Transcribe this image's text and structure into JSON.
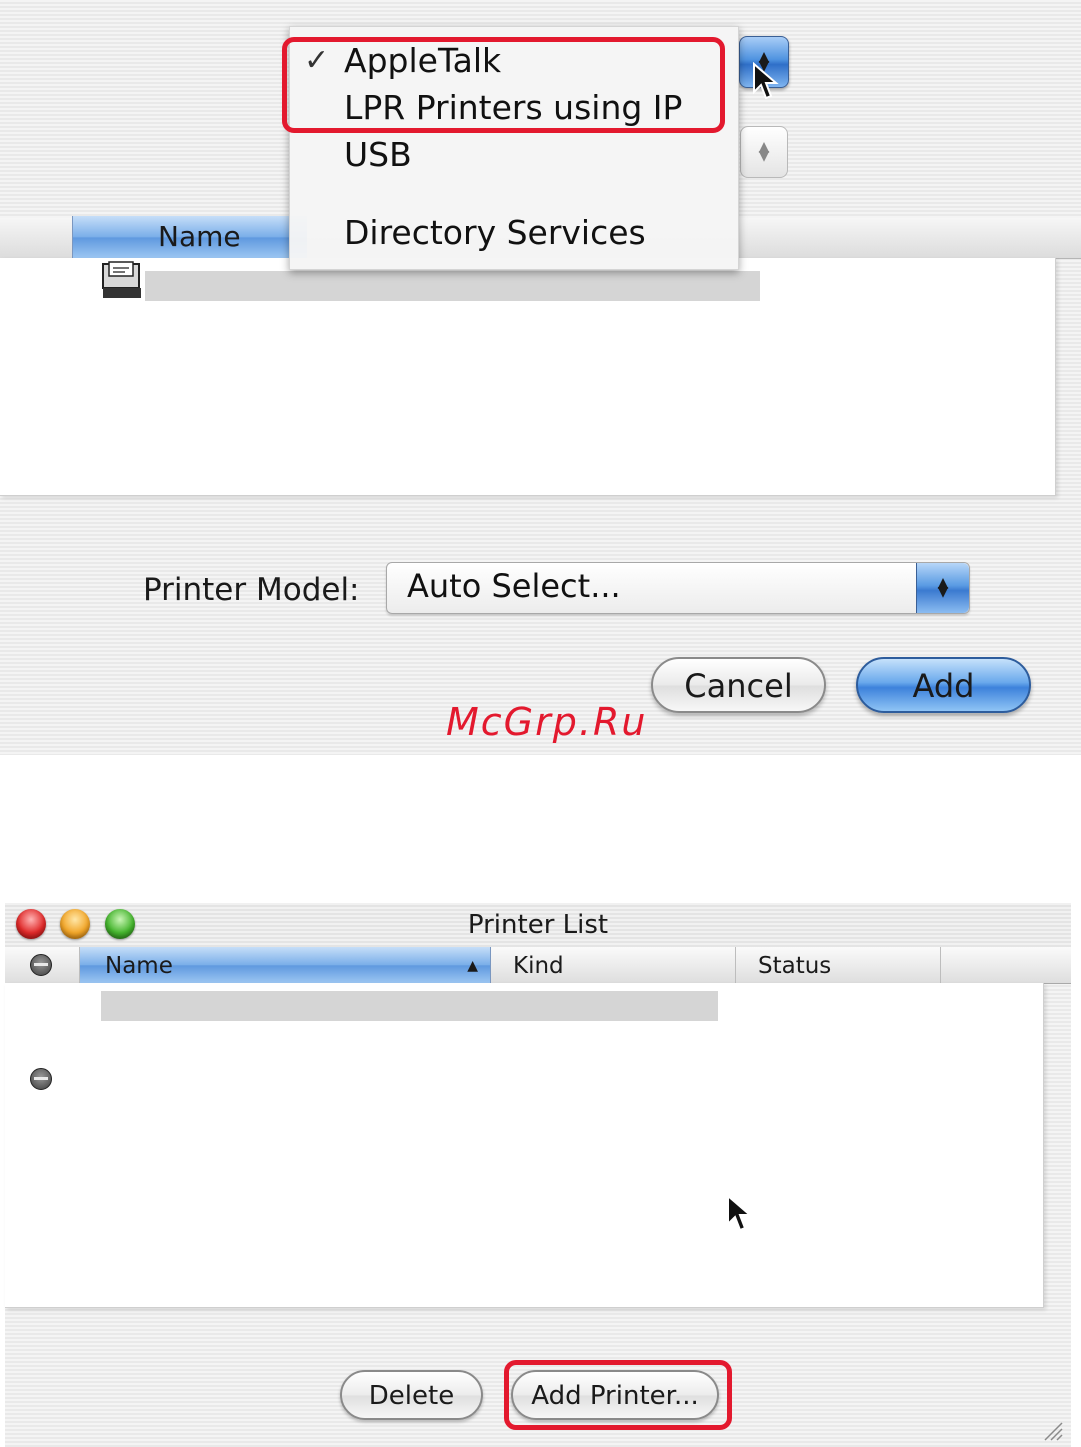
{
  "top_dialog": {
    "connection_menu": {
      "items": [
        {
          "label": "AppleTalk",
          "checked": true
        },
        {
          "label": "LPR Printers using IP",
          "checked": false
        },
        {
          "label": "USB",
          "checked": false
        },
        {
          "label": "Directory Services",
          "checked": false
        }
      ],
      "check_glyph": "✓"
    },
    "list_header": {
      "name": "Name"
    },
    "printer_model": {
      "label": "Printer Model:",
      "value": "Auto Select..."
    },
    "buttons": {
      "cancel": "Cancel",
      "add": "Add"
    },
    "watermark": "McGrp.Ru"
  },
  "printer_list_window": {
    "title": "Printer List",
    "columns": {
      "name": "Name",
      "kind": "Kind",
      "status": "Status"
    },
    "buttons": {
      "delete": "Delete",
      "add_printer": "Add Printer..."
    }
  },
  "colors": {
    "highlight": "#e3192e",
    "aqua_blue": "#3d82db"
  },
  "icons": [
    "check-icon",
    "up-down-arrows-icon",
    "printer-icon",
    "mouse-pointer-icon",
    "status-icon",
    "sort-ascending-icon",
    "resize-grip-icon"
  ]
}
